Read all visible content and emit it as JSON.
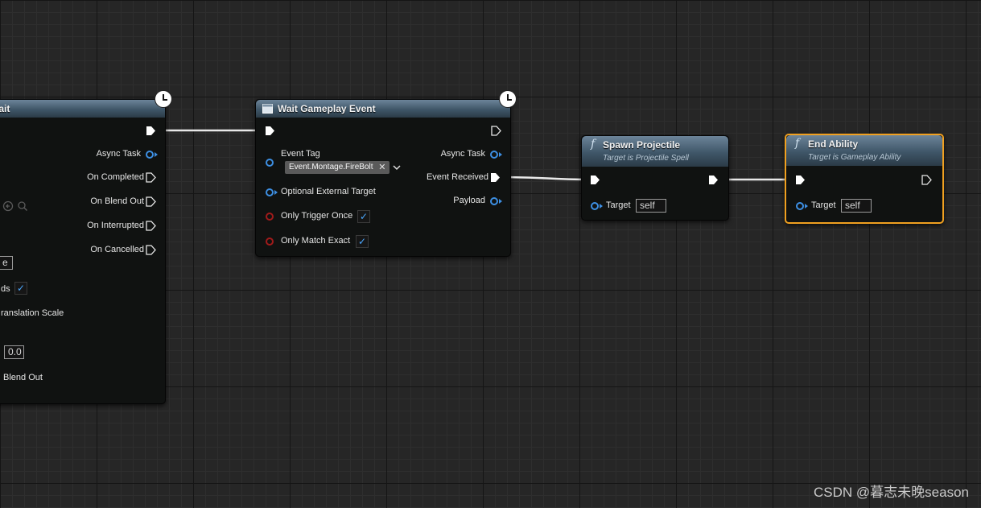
{
  "left_node": {
    "title_fragment": "Vait",
    "outputs": [
      "Async Task",
      "On Completed",
      "On Blend Out",
      "On Interrupted",
      "On Cancelled"
    ],
    "field_fragment_1": "e",
    "checkbox_label_fragment": "ds",
    "label_fragment": "ranslation Scale",
    "number_value": "0.0",
    "blend_out_fragment": "Blend Out"
  },
  "wait_gameplay_event": {
    "title": "Wait Gameplay Event",
    "event_tag_label": "Event Tag",
    "event_tag_value": "Event.Montage.FireBolt",
    "optional_external_target_label": "Optional External Target",
    "only_trigger_once_label": "Only Trigger Once",
    "only_match_exact_label": "Only Match Exact",
    "async_task_label": "Async Task",
    "event_received_label": "Event Received",
    "payload_label": "Payload"
  },
  "spawn_projectile": {
    "title": "Spawn Projectile",
    "subtitle": "Target is Projectile Spell",
    "target_label": "Target",
    "target_value": "self"
  },
  "end_ability": {
    "title": "End Ability",
    "subtitle": "Target is Gameplay Ability",
    "target_label": "Target",
    "target_value": "self"
  },
  "watermark": "CSDN @暮志未晚season",
  "colors": {
    "object_pin": "#3d8fe3",
    "bool_pin": "#a11b1b",
    "selected_border": "#f0a020",
    "checkmark": "#4aa8ff"
  },
  "icons": [
    "clock-icon",
    "function-icon",
    "event-icon",
    "checkmark-icon",
    "close-icon",
    "chevron-down-icon",
    "search-icon",
    "back-icon"
  ]
}
